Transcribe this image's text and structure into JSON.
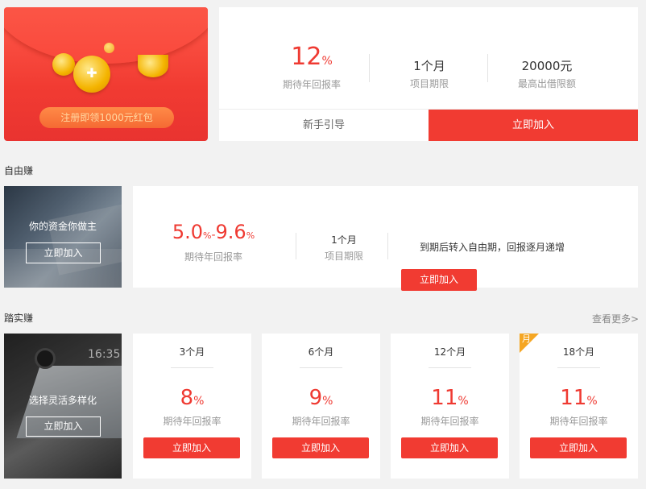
{
  "promo": {
    "button_label": "注册即领1000元红包"
  },
  "top": {
    "rate_value": "12",
    "rate_unit": "%",
    "rate_label": "期待年回报率",
    "period_value": "1个月",
    "period_label": "项目期限",
    "limit_value": "20000元",
    "limit_label": "最高出借限额",
    "guide_label": "新手引导",
    "join_label": "立即加入"
  },
  "free": {
    "section_title": "自由赚",
    "photo_caption": "你的资金你做主",
    "photo_button": "立即加入",
    "rate_low": "5.0",
    "rate_high": "9.6",
    "rate_unit": "%",
    "rate_sep": "-",
    "rate_label": "期待年回报率",
    "period_value": "1个月",
    "period_label": "项目期限",
    "description": "到期后转入自由期，回报逐月递增",
    "join_label": "立即加入"
  },
  "steady": {
    "section_title": "踏实赚",
    "more_label": "查看更多>",
    "photo_caption": "选择灵活多样化",
    "photo_button": "立即加入",
    "photo_text": "16:35",
    "products": [
      {
        "term": "3个月",
        "rate": "8",
        "unit": "%",
        "label": "期待年回报率",
        "button": "立即加入"
      },
      {
        "term": "6个月",
        "rate": "9",
        "unit": "%",
        "label": "期待年回报率",
        "button": "立即加入"
      },
      {
        "term": "12个月",
        "rate": "11",
        "unit": "%",
        "label": "期待年回报率",
        "button": "立即加入"
      },
      {
        "term": "18个月",
        "rate": "11",
        "unit": "%",
        "label": "期待年回报率",
        "button": "立即加入",
        "badge": "月"
      }
    ]
  },
  "colors": {
    "accent": "#f13b32",
    "rate_text": "#ef3a32",
    "badge": "#f5a623",
    "background": "#f2f2f2"
  }
}
